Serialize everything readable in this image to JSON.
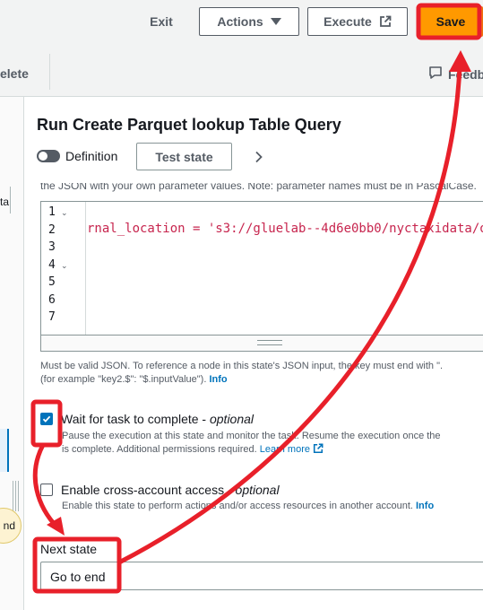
{
  "topbar": {
    "exit_label": "Exit",
    "actions_label": "Actions",
    "execute_label": "Execute",
    "save_label": "Save"
  },
  "toolbar": {
    "delete_label": "elete",
    "feedback_label": "Feedb"
  },
  "canvas": {
    "partial_text": "ta",
    "node_text": "nd"
  },
  "panel": {
    "title": "Run Create Parquet lookup Table Query",
    "definition_label": "Definition",
    "definition_toggle": "off",
    "test_state_label": "Test state",
    "partial_description": "the JSON with your own parameter values. Note: parameter names must be in PascalCase."
  },
  "code_editor": {
    "line_numbers": [
      "1",
      "2",
      "3",
      "4",
      "5",
      "6",
      "7"
    ],
    "line2_text": "rnal_location = 's3://gluelab--4d6e0bb0/nyctaxidata/o"
  },
  "help": {
    "line1": "Must be valid JSON. To reference a node in this state's JSON input, the key must end with \".",
    "line2": "(for example \"key2.$\": \"$.inputValue\").",
    "info": "Info"
  },
  "wait_task": {
    "label": "Wait for task to complete - ",
    "optional": "optional",
    "checked": true,
    "desc_line1": "Pause the execution at this state and monitor the task. Resume the execution once the",
    "desc_line2": "is complete. Additional permissions required.",
    "learn_more": "Learn more"
  },
  "cross_account": {
    "label": "Enable cross-account access - ",
    "optional": "optional",
    "checked": false,
    "desc": "Enable this state to perform actions and/or access resources in another account.",
    "info": "Info"
  },
  "next_state": {
    "label": "Next state",
    "value": "Go to end"
  },
  "colors": {
    "save_bg": "#ff9900",
    "annotation_red": "#e8202a",
    "link_blue": "#0073bb",
    "code_red": "#c7254e"
  }
}
